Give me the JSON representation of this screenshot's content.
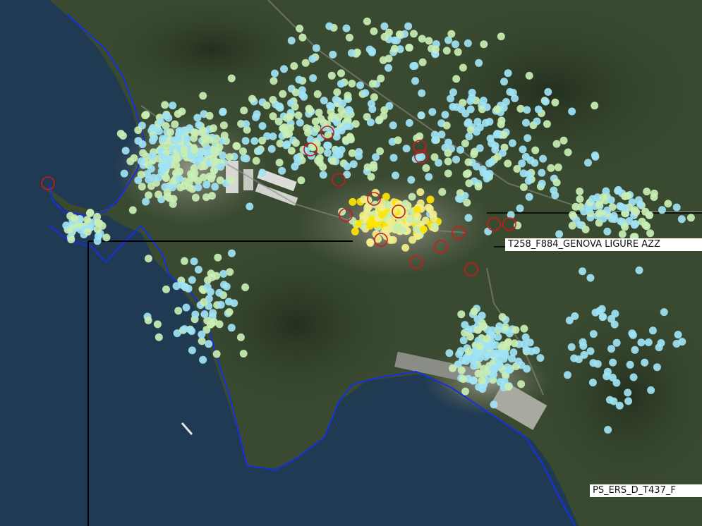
{
  "map": {
    "labels": [
      {
        "text": "T258_F884_GENOVA LIGURE AZZ"
      },
      {
        "text": "PS_ERS_D_T437_F"
      }
    ],
    "colors": {
      "sea": "#1f3a52",
      "land_dark": "#2c3a27",
      "land_mid": "#3c4d33",
      "urban": "#8a8a80",
      "coastline": "#1530e0",
      "boundary": "#000000",
      "highlight_outline": "#d01818",
      "point_low": "#9fe3f5",
      "point_mid": "#c9eeb4",
      "point_high": "#f2ee8c",
      "point_peak": "#ffe400"
    }
  }
}
